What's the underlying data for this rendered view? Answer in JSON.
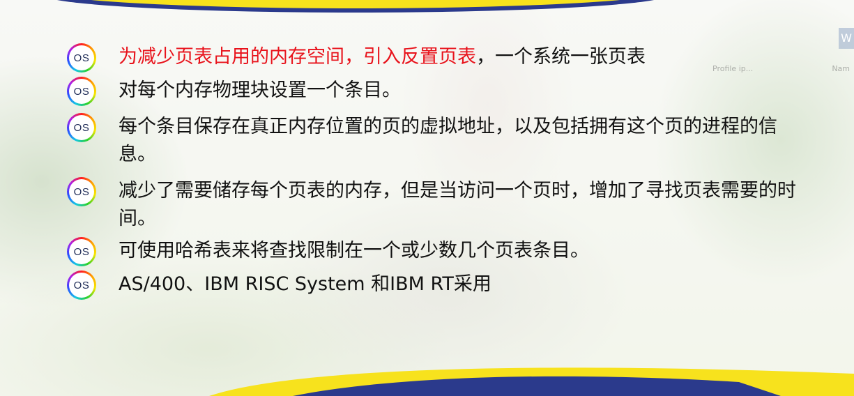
{
  "colors": {
    "highlight_red": "#e8121b",
    "text": "#111111",
    "band_yellow": "#f7e21d",
    "band_blue": "#2b3a8c"
  },
  "bullet_icon": {
    "label": "OS",
    "icon": "os-rainbow-ring-icon"
  },
  "background_ui": {
    "corner_letter": "W",
    "faint_text_1": "Profile ip...",
    "faint_text_2": "Nam"
  },
  "bullets": [
    {
      "highlight": "为减少页表占用的内存空间，引入反置页表",
      "text": "，一个系统一张页表"
    },
    {
      "text": "对每个内存物理块设置一个条目。"
    },
    {
      "text": "每个条目保存在真正内存位置的页的虚拟地址，以及包括拥有这个页的进程的信息。"
    },
    {
      "text": "减少了需要储存每个页表的内存，但是当访问一个页时，增加了寻找页表需要的时间。"
    },
    {
      "text": "可使用哈希表来将查找限制在一个或少数几个页表条目。"
    },
    {
      "text": "AS/400、IBM RISC System 和IBM RT采用"
    }
  ]
}
